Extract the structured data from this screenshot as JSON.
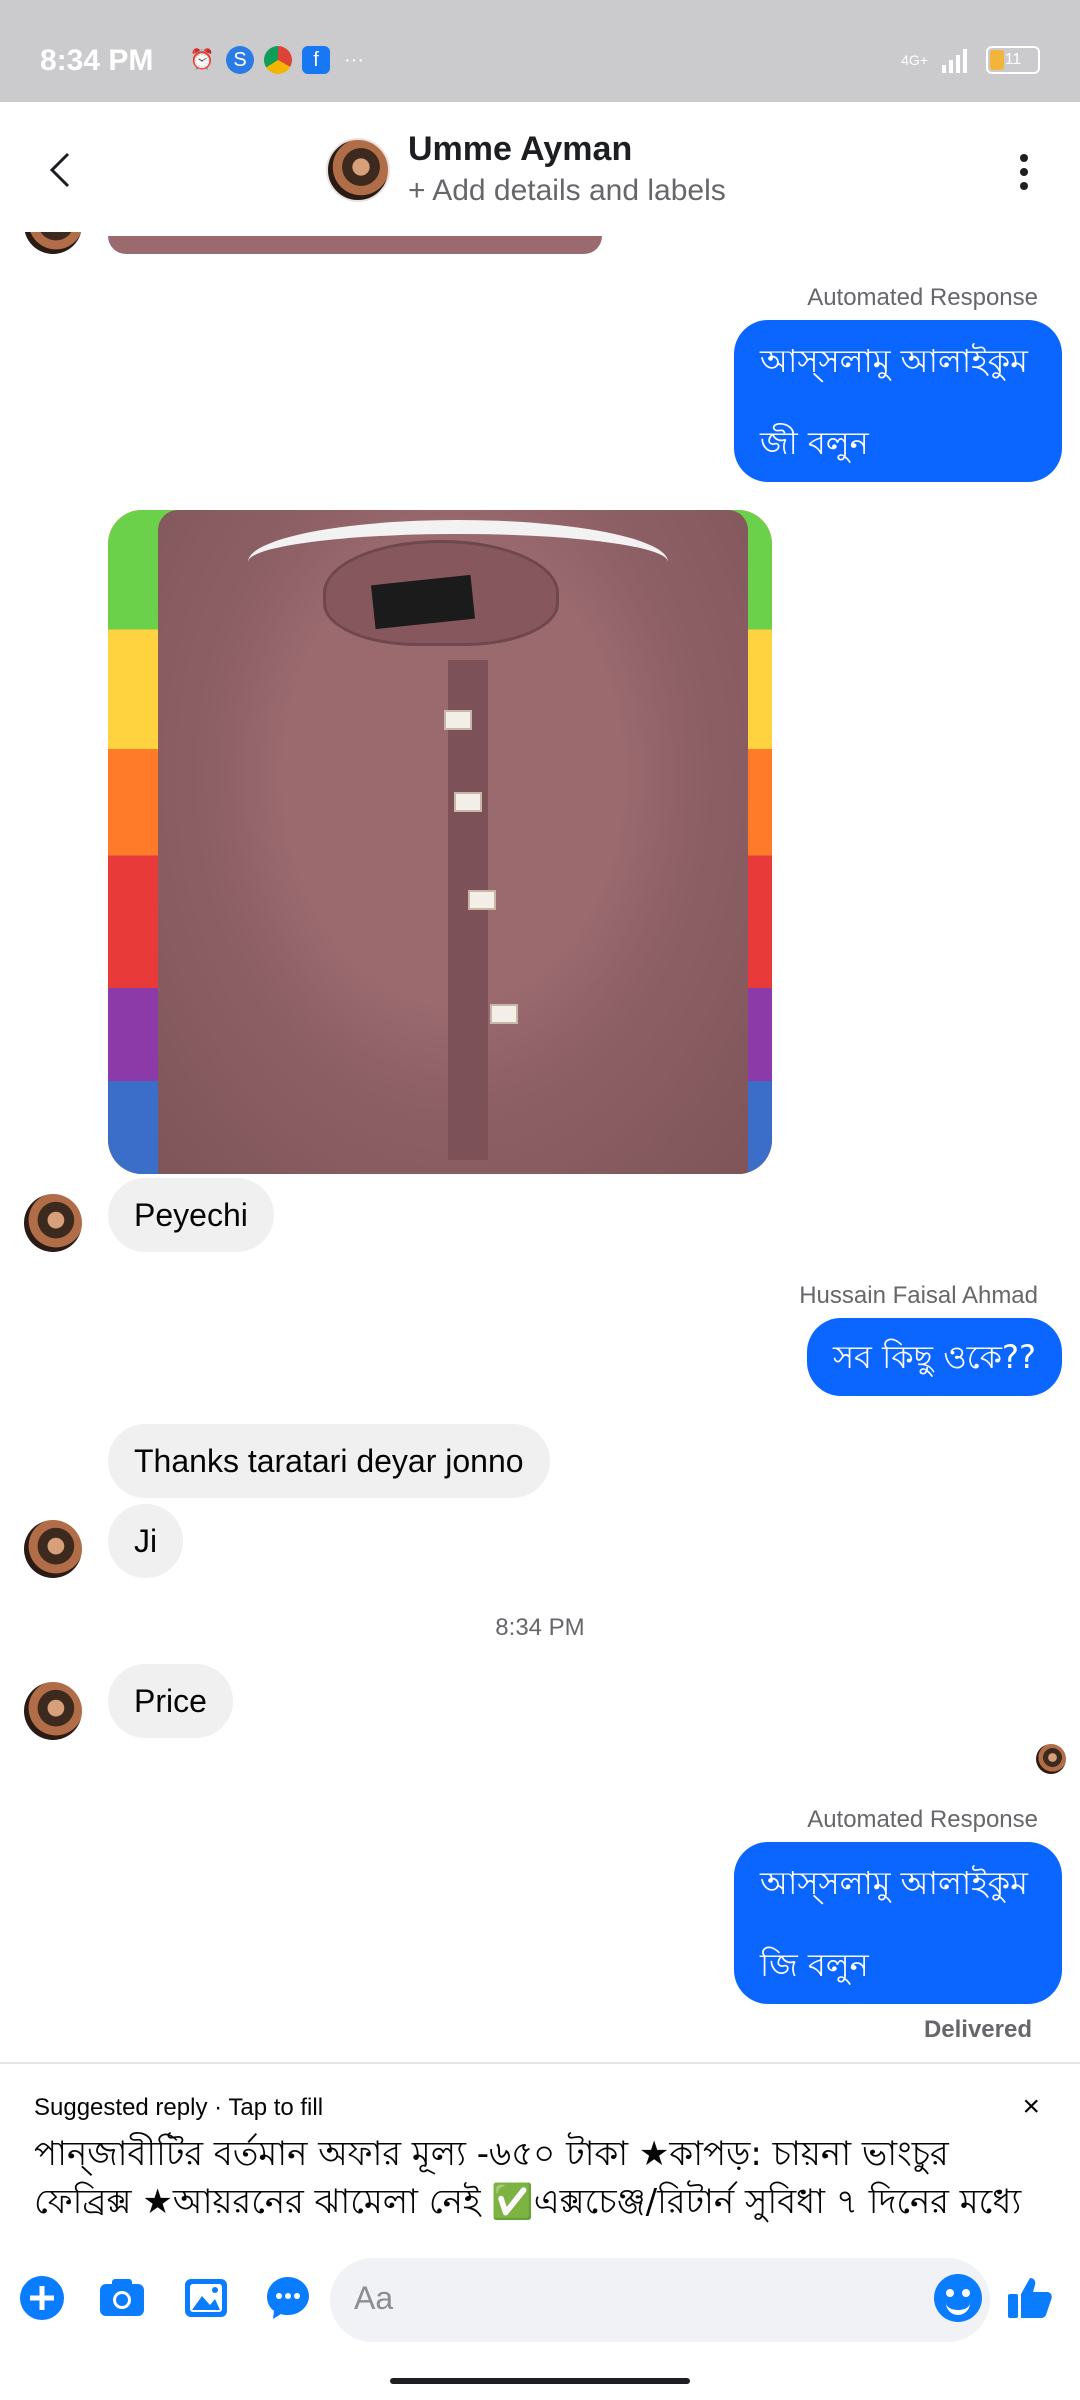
{
  "status_bar": {
    "time": "8:34 PM",
    "icons": [
      "alarm-icon",
      "shazam-icon",
      "chrome-icon",
      "facebook-icon",
      "more-dots-icon"
    ],
    "network": "4G+",
    "battery": "11"
  },
  "header": {
    "contact_name": "Umme Ayman",
    "subtitle": "+ Add details and labels"
  },
  "messages": [
    {
      "label": "Automated Response",
      "lines": [
        "আস্সলামু আলাইকুম",
        "জী বলুন"
      ]
    },
    {
      "text": "Peyechi"
    },
    {
      "label": "Hussain Faisal Ahmad",
      "text": "সব কিছু ওকে??"
    },
    {
      "text": "Thanks taratari deyar jonno"
    },
    {
      "text": "Ji"
    },
    {
      "time_divider": "8:34 PM"
    },
    {
      "text": "Price"
    },
    {
      "label": "Automated Response",
      "lines": [
        "আস্সলামু আলাইকুম",
        "জি বলুন"
      ]
    },
    {
      "status": "Delivered"
    }
  ],
  "suggested": {
    "title": "Suggested reply · Tap to fill",
    "text": "পান্জাবীটির বর্তমান অফার মূল্য -৬৫০ টাকা ★কাপড়: চায়না ভাংচুর ফেব্রিক্স ★আয়রনের ঝামেলা নেই ✅এক্সচেঞ্জ/রিটার্ন সুবিধা ৭ দিনের মধ্যে",
    "close": "×"
  },
  "composer": {
    "placeholder": "Aa"
  },
  "colors": {
    "accent": "#0a66ff",
    "incoming_bubble": "#f0f0f0"
  }
}
